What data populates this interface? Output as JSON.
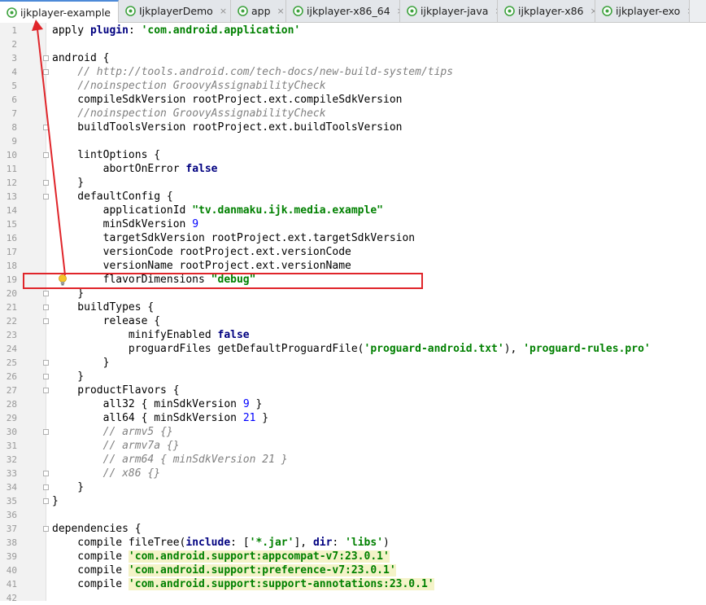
{
  "tabs": [
    {
      "label": "ijkplayer-example",
      "active": true
    },
    {
      "label": "IjkplayerDemo",
      "active": false
    },
    {
      "label": "app",
      "active": false
    },
    {
      "label": "ijkplayer-x86_64",
      "active": false
    },
    {
      "label": "ijkplayer-java",
      "active": false
    },
    {
      "label": "ijkplayer-x86",
      "active": false
    },
    {
      "label": "ijkplayer-exo",
      "active": false
    }
  ],
  "close_glyph": "×",
  "lines": [
    {
      "n": "1",
      "segs": [
        {
          "t": "apply "
        },
        {
          "t": "plugin",
          "k": "kw"
        },
        {
          "t": ": "
        },
        {
          "t": "'com.android.application'",
          "k": "str"
        }
      ]
    },
    {
      "n": "2",
      "segs": []
    },
    {
      "n": "3",
      "fold": true,
      "segs": [
        {
          "t": "android {"
        }
      ]
    },
    {
      "n": "4",
      "fold": true,
      "segs": [
        {
          "t": "    "
        },
        {
          "t": "// http://tools.android.com/tech-docs/new-build-system/tips",
          "k": "cm"
        }
      ]
    },
    {
      "n": "5",
      "segs": [
        {
          "t": "    "
        },
        {
          "t": "//noinspection GroovyAssignabilityCheck",
          "k": "cm"
        }
      ]
    },
    {
      "n": "6",
      "segs": [
        {
          "t": "    compileSdkVersion rootProject.ext.compileSdkVersion"
        }
      ]
    },
    {
      "n": "7",
      "segs": [
        {
          "t": "    "
        },
        {
          "t": "//noinspection GroovyAssignabilityCheck",
          "k": "cm"
        }
      ]
    },
    {
      "n": "8",
      "fold": true,
      "segs": [
        {
          "t": "    buildToolsVersion rootProject.ext.buildToolsVersion"
        }
      ]
    },
    {
      "n": "9",
      "segs": []
    },
    {
      "n": "10",
      "fold": true,
      "segs": [
        {
          "t": "    lintOptions {"
        }
      ]
    },
    {
      "n": "11",
      "segs": [
        {
          "t": "        abortOnError "
        },
        {
          "t": "false",
          "k": "kw"
        }
      ]
    },
    {
      "n": "12",
      "fold": true,
      "segs": [
        {
          "t": "    }"
        }
      ]
    },
    {
      "n": "13",
      "fold": true,
      "segs": [
        {
          "t": "    defaultConfig {"
        }
      ]
    },
    {
      "n": "14",
      "segs": [
        {
          "t": "        applicationId "
        },
        {
          "t": "\"tv.danmaku.ijk.media.example\"",
          "k": "str"
        }
      ]
    },
    {
      "n": "15",
      "segs": [
        {
          "t": "        minSdkVersion "
        },
        {
          "t": "9",
          "k": "num"
        }
      ]
    },
    {
      "n": "16",
      "segs": [
        {
          "t": "        targetSdkVersion rootProject.ext.targetSdkVersion"
        }
      ]
    },
    {
      "n": "17",
      "segs": [
        {
          "t": "        versionCode rootProject.ext.versionCode"
        }
      ]
    },
    {
      "n": "18",
      "segs": [
        {
          "t": "        versionName rootProject.ext.versionName"
        }
      ]
    },
    {
      "n": "19",
      "bulb": true,
      "segs": [
        {
          "t": "        flavorDimensions "
        },
        {
          "t": "\"debug\"",
          "k": "str"
        }
      ]
    },
    {
      "n": "20",
      "fold": true,
      "segs": [
        {
          "t": "    }"
        }
      ]
    },
    {
      "n": "21",
      "fold": true,
      "segs": [
        {
          "t": "    buildTypes {"
        }
      ]
    },
    {
      "n": "22",
      "fold": true,
      "segs": [
        {
          "t": "        release {"
        }
      ]
    },
    {
      "n": "23",
      "segs": [
        {
          "t": "            minifyEnabled "
        },
        {
          "t": "false",
          "k": "kw"
        }
      ]
    },
    {
      "n": "24",
      "segs": [
        {
          "t": "            proguardFiles getDefaultProguardFile("
        },
        {
          "t": "'proguard-android.txt'",
          "k": "str"
        },
        {
          "t": "), "
        },
        {
          "t": "'proguard-rules.pro'",
          "k": "str"
        }
      ]
    },
    {
      "n": "25",
      "fold": true,
      "segs": [
        {
          "t": "        }"
        }
      ]
    },
    {
      "n": "26",
      "fold": true,
      "segs": [
        {
          "t": "    }"
        }
      ]
    },
    {
      "n": "27",
      "fold": true,
      "segs": [
        {
          "t": "    productFlavors {"
        }
      ]
    },
    {
      "n": "28",
      "segs": [
        {
          "t": "        all32 { minSdkVersion "
        },
        {
          "t": "9",
          "k": "num"
        },
        {
          "t": " }"
        }
      ]
    },
    {
      "n": "29",
      "segs": [
        {
          "t": "        all64 { minSdkVersion "
        },
        {
          "t": "21",
          "k": "num"
        },
        {
          "t": " }"
        }
      ]
    },
    {
      "n": "30",
      "fold": true,
      "segs": [
        {
          "t": "        "
        },
        {
          "t": "// armv5 {}",
          "k": "cm"
        }
      ]
    },
    {
      "n": "31",
      "segs": [
        {
          "t": "        "
        },
        {
          "t": "// armv7a {}",
          "k": "cm"
        }
      ]
    },
    {
      "n": "32",
      "segs": [
        {
          "t": "        "
        },
        {
          "t": "// arm64 { minSdkVersion 21 }",
          "k": "cm"
        }
      ]
    },
    {
      "n": "33",
      "fold": true,
      "segs": [
        {
          "t": "        "
        },
        {
          "t": "// x86 {}",
          "k": "cm"
        }
      ]
    },
    {
      "n": "34",
      "fold": true,
      "segs": [
        {
          "t": "    }"
        }
      ]
    },
    {
      "n": "35",
      "fold": true,
      "segs": [
        {
          "t": "}"
        }
      ]
    },
    {
      "n": "36",
      "segs": []
    },
    {
      "n": "37",
      "fold": true,
      "segs": [
        {
          "t": "dependencies {"
        }
      ]
    },
    {
      "n": "38",
      "segs": [
        {
          "t": "    compile fileTree("
        },
        {
          "t": "include",
          "k": "kw"
        },
        {
          "t": ": ["
        },
        {
          "t": "'*.jar'",
          "k": "str"
        },
        {
          "t": "], "
        },
        {
          "t": "dir",
          "k": "kw"
        },
        {
          "t": ": "
        },
        {
          "t": "'libs'",
          "k": "str"
        },
        {
          "t": ")"
        }
      ]
    },
    {
      "n": "39",
      "segs": [
        {
          "t": "    compile "
        },
        {
          "t": "'com.android.support:appcompat-v7:23.0.1'",
          "k": "str hl"
        }
      ]
    },
    {
      "n": "40",
      "segs": [
        {
          "t": "    compile "
        },
        {
          "t": "'com.android.support:preference-v7:23.0.1'",
          "k": "str hl"
        }
      ]
    },
    {
      "n": "41",
      "segs": [
        {
          "t": "    compile "
        },
        {
          "t": "'com.android.support:support-annotations:23.0.1'",
          "k": "str hl"
        }
      ]
    },
    {
      "n": "42",
      "segs": []
    }
  ],
  "colors": {
    "annotation_red": "#e0252a",
    "keyword": "#000080",
    "string": "#008000",
    "comment": "#808080",
    "number": "#0000ff"
  },
  "icons": {
    "tab": "gradle-module-icon",
    "bulb": "lightbulb-icon",
    "fold": "fold-marker-icon"
  }
}
